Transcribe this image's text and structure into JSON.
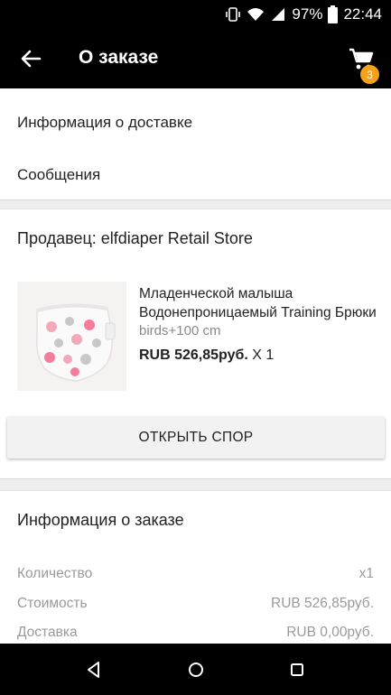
{
  "status": {
    "battery": "97%",
    "time": "22:44"
  },
  "appbar": {
    "title": "О заказе",
    "cart_count": "3"
  },
  "links": {
    "delivery": "Информация о доставке",
    "messages": "Сообщения"
  },
  "order": {
    "seller": "Продавец: elfdiaper Retail Store",
    "product_name_line1": "Младенческой малыша",
    "product_name_line2": "Водонепроницаемый Training Брюки",
    "variant": "birds+100 cm",
    "price": "RUB 526,85руб.",
    "qty": "X 1",
    "dispute_button": "ОТКРЫТЬ СПОР"
  },
  "info": {
    "title": "Информация о заказе",
    "rows": [
      {
        "label": "Количество",
        "value": "x1"
      },
      {
        "label": "Стоимость",
        "value": "RUB 526,85руб."
      },
      {
        "label": "Доставка",
        "value": "RUB 0,00руб."
      }
    ]
  },
  "icons": {
    "back": "arrow-left-icon",
    "cart": "shopping-cart-icon",
    "nav_back": "triangle-back-icon",
    "nav_home": "circle-home-icon",
    "nav_recents": "square-recents-icon"
  },
  "colors": {
    "bar": "#000000",
    "badge": "#f5a11c",
    "background": "#eeeeee",
    "muted": "#9a9a9a"
  }
}
